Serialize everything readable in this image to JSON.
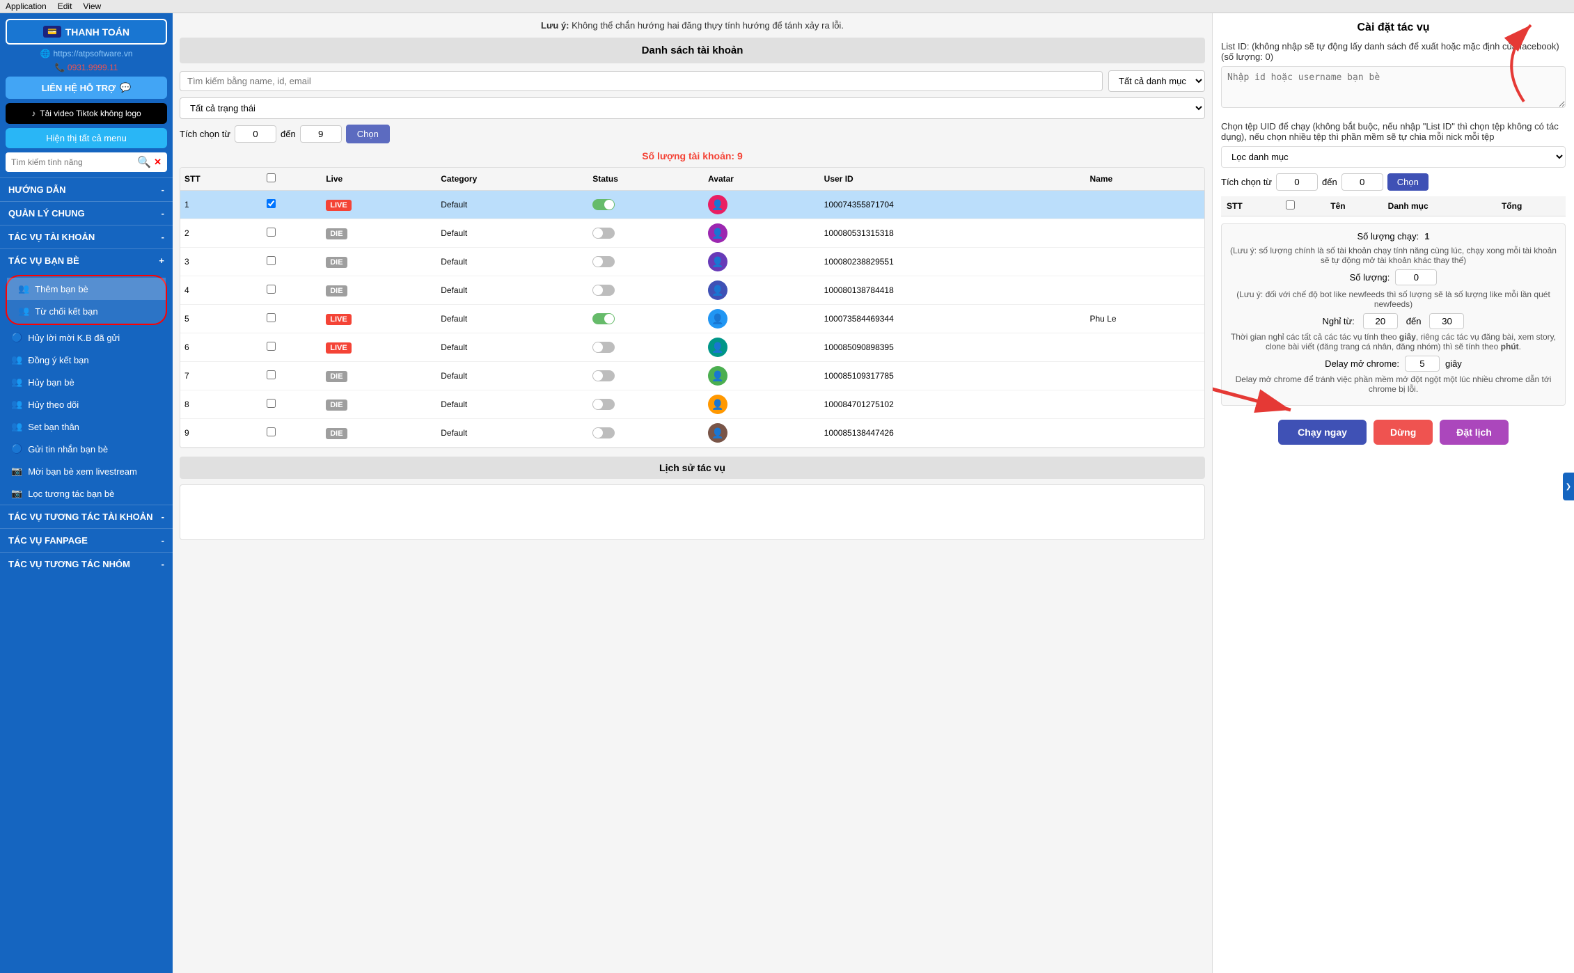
{
  "menubar": {
    "items": [
      "Application",
      "Edit",
      "View"
    ]
  },
  "sidebar": {
    "thanh_toan": "THANH TOÁN",
    "website": "https://atpsoftware.vn",
    "phone": "0931.9999.11",
    "lien_he": "LIÊN HỆ HỖ TRỢ",
    "tiktok": "Tải video Tiktok không logo",
    "hien_thi": "Hiện thị tất cả menu",
    "search_placeholder": "Tìm kiếm tính năng",
    "nav_items": [
      {
        "id": "huong-dan",
        "label": "HƯỚNG DẪN",
        "symbol": "-"
      },
      {
        "id": "quan-ly-chung",
        "label": "QUẢN LÝ CHUNG",
        "symbol": "-"
      },
      {
        "id": "tac-vu-tai-khoan",
        "label": "TÁC VỤ TÀI KHOẢN",
        "symbol": "-"
      },
      {
        "id": "tac-vu-ban-be",
        "label": "TÁC VỤ BẠN BÈ",
        "symbol": "+"
      }
    ],
    "sub_items": [
      {
        "id": "them-ban-be",
        "label": "Thêm bạn bè",
        "icon": "👥",
        "active": true
      },
      {
        "id": "tu-choi-ket-ban",
        "label": "Từ chối kết bạn",
        "icon": "👥"
      },
      {
        "id": "huy-loi-moi",
        "label": "Hủy lời mời K.B đã gửi",
        "icon": "🔵"
      },
      {
        "id": "dong-y-ket-ban",
        "label": "Đồng ý kết bạn",
        "icon": "👥"
      },
      {
        "id": "huy-ban-be",
        "label": "Hủy bạn bè",
        "icon": "👥"
      },
      {
        "id": "huy-theo-doi",
        "label": "Hủy theo dõi",
        "icon": "👥"
      },
      {
        "id": "set-ban-than",
        "label": "Set bạn thân",
        "icon": "👥"
      },
      {
        "id": "gui-tin-nhan",
        "label": "Gửi tin nhắn bạn bè",
        "icon": "🔵"
      },
      {
        "id": "moi-ban-be",
        "label": "Mời bạn bè xem livestream",
        "icon": "📷"
      },
      {
        "id": "loc-tuong-tac",
        "label": "Lọc tương tác bạn bè",
        "icon": "📷"
      }
    ],
    "nav_bottom": [
      {
        "id": "tac-vu-tuong-tac",
        "label": "TÁC VỤ TƯƠNG TÁC TÀI KHOẢN",
        "symbol": "-"
      },
      {
        "id": "tac-vu-fanpage",
        "label": "TÁC VỤ FANPAGE",
        "symbol": "-"
      },
      {
        "id": "tac-vu-nhom",
        "label": "TÁC VỤ TƯƠNG TÁC NHÓM",
        "symbol": "-"
      }
    ]
  },
  "middle": {
    "warning": "tánh xảy ra lỗi.",
    "section_title": "Danh sách tài khoản",
    "search_placeholder": "Tìm kiếm bằng name, id, email",
    "category_options": [
      "Tất cả danh mục"
    ],
    "status_options": [
      "Tất cả trạng thái"
    ],
    "select_from": "0",
    "select_to": "9",
    "btn_chon": "Chọn",
    "account_count_label": "Số lượng tài khoản:",
    "account_count": "9",
    "table_headers": [
      "STT",
      "",
      "Live",
      "Category",
      "Status",
      "Avatar",
      "User ID",
      "Name"
    ],
    "accounts": [
      {
        "stt": 1,
        "checked": true,
        "live": "LIVE",
        "category": "Default",
        "user_id": "100074355871704",
        "name": "",
        "selected": true
      },
      {
        "stt": 2,
        "checked": false,
        "live": "DIE",
        "category": "Default",
        "user_id": "100080531315318",
        "name": ""
      },
      {
        "stt": 3,
        "checked": false,
        "live": "DIE",
        "category": "Default",
        "user_id": "100080238829551",
        "name": ""
      },
      {
        "stt": 4,
        "checked": false,
        "live": "DIE",
        "category": "Default",
        "user_id": "100080138784418",
        "name": ""
      },
      {
        "stt": 5,
        "checked": false,
        "live": "LIVE",
        "category": "Default",
        "user_id": "100073584469344",
        "name": "Phu Le"
      },
      {
        "stt": 6,
        "checked": false,
        "live": "LIVE",
        "category": "Default",
        "user_id": "100085090898395",
        "name": ""
      },
      {
        "stt": 7,
        "checked": false,
        "live": "DIE",
        "category": "Default",
        "user_id": "100085109317785",
        "name": ""
      },
      {
        "stt": 8,
        "checked": false,
        "live": "DIE",
        "category": "Default",
        "user_id": "100084701275102",
        "name": ""
      },
      {
        "stt": 9,
        "checked": false,
        "live": "DIE",
        "category": "Default",
        "user_id": "100085138447426",
        "name": ""
      }
    ],
    "history_title": "Lịch sử tác vụ"
  },
  "right": {
    "title": "Cài đặt tác vụ",
    "list_id_label": "List ID: (không nhập sẽ tự động lấy danh sách để xuất hoặc mặc định của facebook)(số lượng: 0)",
    "list_id_placeholder": "Nhập id hoặc username bạn bè",
    "uid_file_label": "Chọn tệp UID để chạy (không bắt buộc, nếu nhập \"List ID\" thì chọn tệp không có tác dụng), nếu chọn nhiều tệp thì phần mềm sẽ tự chia mỗi nick mỗi tệp",
    "folder_placeholder": "Lọc danh mục",
    "select_from": "0",
    "select_to": "0",
    "btn_chon": "Chọn",
    "table_headers": [
      "STT",
      "",
      "Tên",
      "Danh mục",
      "Tổng"
    ],
    "stats": {
      "so_luong_chay_label": "Số lượng chạy:",
      "so_luong_chay_value": "1",
      "so_luong_chay_note": "(Lưu ý: số lượng chính là số tài khoản chạy tính năng cùng lúc, chạy xong mỗi tài khoản sẽ tự động mở tài khoản khác thay thế)",
      "so_luong_label": "Số lượng:",
      "so_luong_value": "0",
      "so_luong_note": "(Lưu ý: đối với chế độ bot like newfeeds thì số lượng sẽ là số lượng like mỗi lần quét newfeeds)",
      "nghi_tu_label": "Nghỉ từ:",
      "nghi_tu": "20",
      "den_label": "đến",
      "nghi_den": "30",
      "time_note": "Thời gian nghỉ các tất cả các tác vụ tính theo giây, riêng các tác vụ đăng bài, xem story, clone bài viết (đăng trang cá nhân, đăng nhóm) thì sẽ tính theo phút.",
      "delay_label": "Delay mở chrome:",
      "delay_value": "5",
      "delay_unit": "giây",
      "delay_note": "Delay mở chrome để tránh việc phần mềm mở đột ngột một lúc nhiều chrome dẫn tới chrome bị lỗi."
    },
    "buttons": {
      "chay": "Chạy ngay",
      "dung": "Dừng",
      "dat_lich": "Đặt lịch"
    }
  }
}
